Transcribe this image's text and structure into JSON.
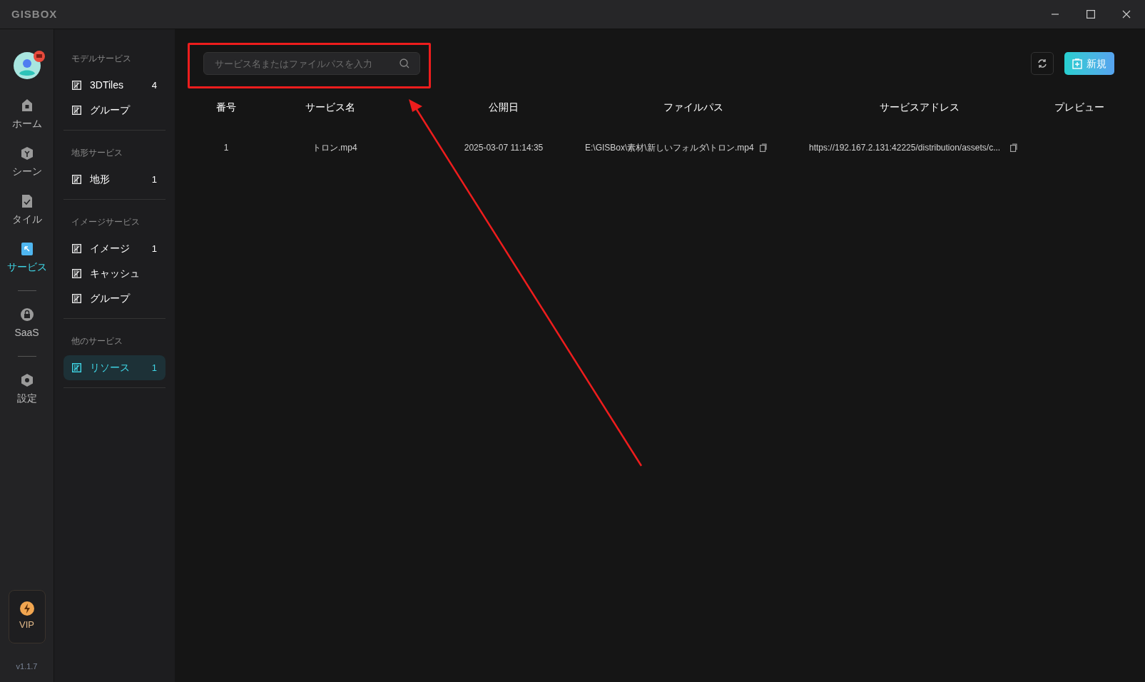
{
  "app": {
    "logo": "GISBOX"
  },
  "nav_rail": {
    "items": [
      {
        "kind": "item",
        "label": "ホーム",
        "selected": false
      },
      {
        "kind": "item",
        "label": "シーン",
        "selected": false
      },
      {
        "kind": "item",
        "label": "タイル",
        "selected": false
      },
      {
        "kind": "item",
        "label": "サービス",
        "selected": true
      },
      {
        "kind": "divider"
      },
      {
        "kind": "item",
        "label": "SaaS",
        "selected": false
      },
      {
        "kind": "divider"
      },
      {
        "kind": "item",
        "label": "設定",
        "selected": false
      }
    ],
    "vip": "VIP",
    "version": "v1.1.7"
  },
  "sidebar": {
    "sections": [
      {
        "title": "モデルサービス",
        "items": [
          {
            "label": "3DTiles",
            "count": "4",
            "selected": false
          },
          {
            "label": "グループ",
            "selected": false
          }
        ]
      },
      {
        "title": "地形サービス",
        "items": [
          {
            "label": "地形",
            "count": "1",
            "selected": false
          }
        ]
      },
      {
        "title": "イメージサービス",
        "items": [
          {
            "label": "イメージ",
            "count": "1",
            "selected": false
          },
          {
            "label": "キャッシュ",
            "selected": false
          },
          {
            "label": "グループ",
            "selected": false
          }
        ]
      },
      {
        "title": "他のサービス",
        "items": [
          {
            "label": "リソース",
            "count": "1",
            "selected": true
          }
        ]
      }
    ]
  },
  "toolbar": {
    "search": {
      "placeholder": "サービス名またはファイルパスを入力"
    },
    "new_button": "新規"
  },
  "table": {
    "columns": [
      "番号",
      "サービス名",
      "公開日",
      "ファイルパス",
      "サービスアドレス",
      "プレビュー"
    ],
    "rows": [
      {
        "cells": [
          "1",
          "トロン.mp4",
          "2025-03-07 11:14:35",
          "E:\\GISBox\\素材\\新しいフォルダ\\トロン.mp4",
          "https://192.167.2.131:42225/distribution/assets/c..."
        ]
      }
    ]
  }
}
